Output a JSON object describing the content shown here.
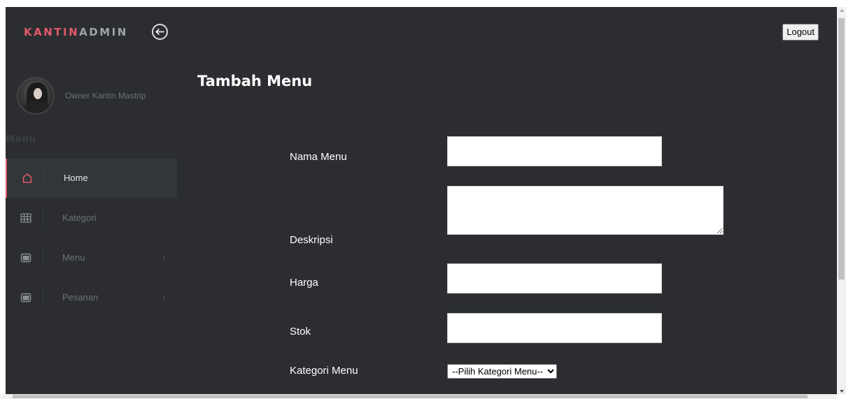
{
  "header": {
    "brand_part1": "KANTIN",
    "brand_part2": "ADMIN",
    "logout_label": "Logout"
  },
  "sidebar": {
    "profile_name": "Owner Kantin Mastrip",
    "section_title": "Menu",
    "items": [
      {
        "label": "Home",
        "icon": "home-icon",
        "active": true
      },
      {
        "label": "Kategori",
        "icon": "grid-icon",
        "active": false
      },
      {
        "label": "Menu",
        "icon": "window-icon",
        "active": false,
        "chevron": "‹"
      },
      {
        "label": "Pesanan",
        "icon": "window-icon",
        "active": false,
        "chevron": "‹"
      }
    ]
  },
  "main": {
    "title": "Tambah Menu",
    "form": {
      "nama_label": "Nama Menu",
      "nama_value": "",
      "deskripsi_label": "Deskripsi",
      "deskripsi_value": "",
      "harga_label": "Harga",
      "harga_value": "",
      "stok_label": "Stok",
      "stok_value": "",
      "kategori_label": "Kategori Menu",
      "kategori_selected": "--Pilih Kategori Menu--"
    }
  },
  "colors": {
    "background": "#2b2d30",
    "accent": "#e05a6a",
    "brand_secondary": "#9fa3a8"
  }
}
